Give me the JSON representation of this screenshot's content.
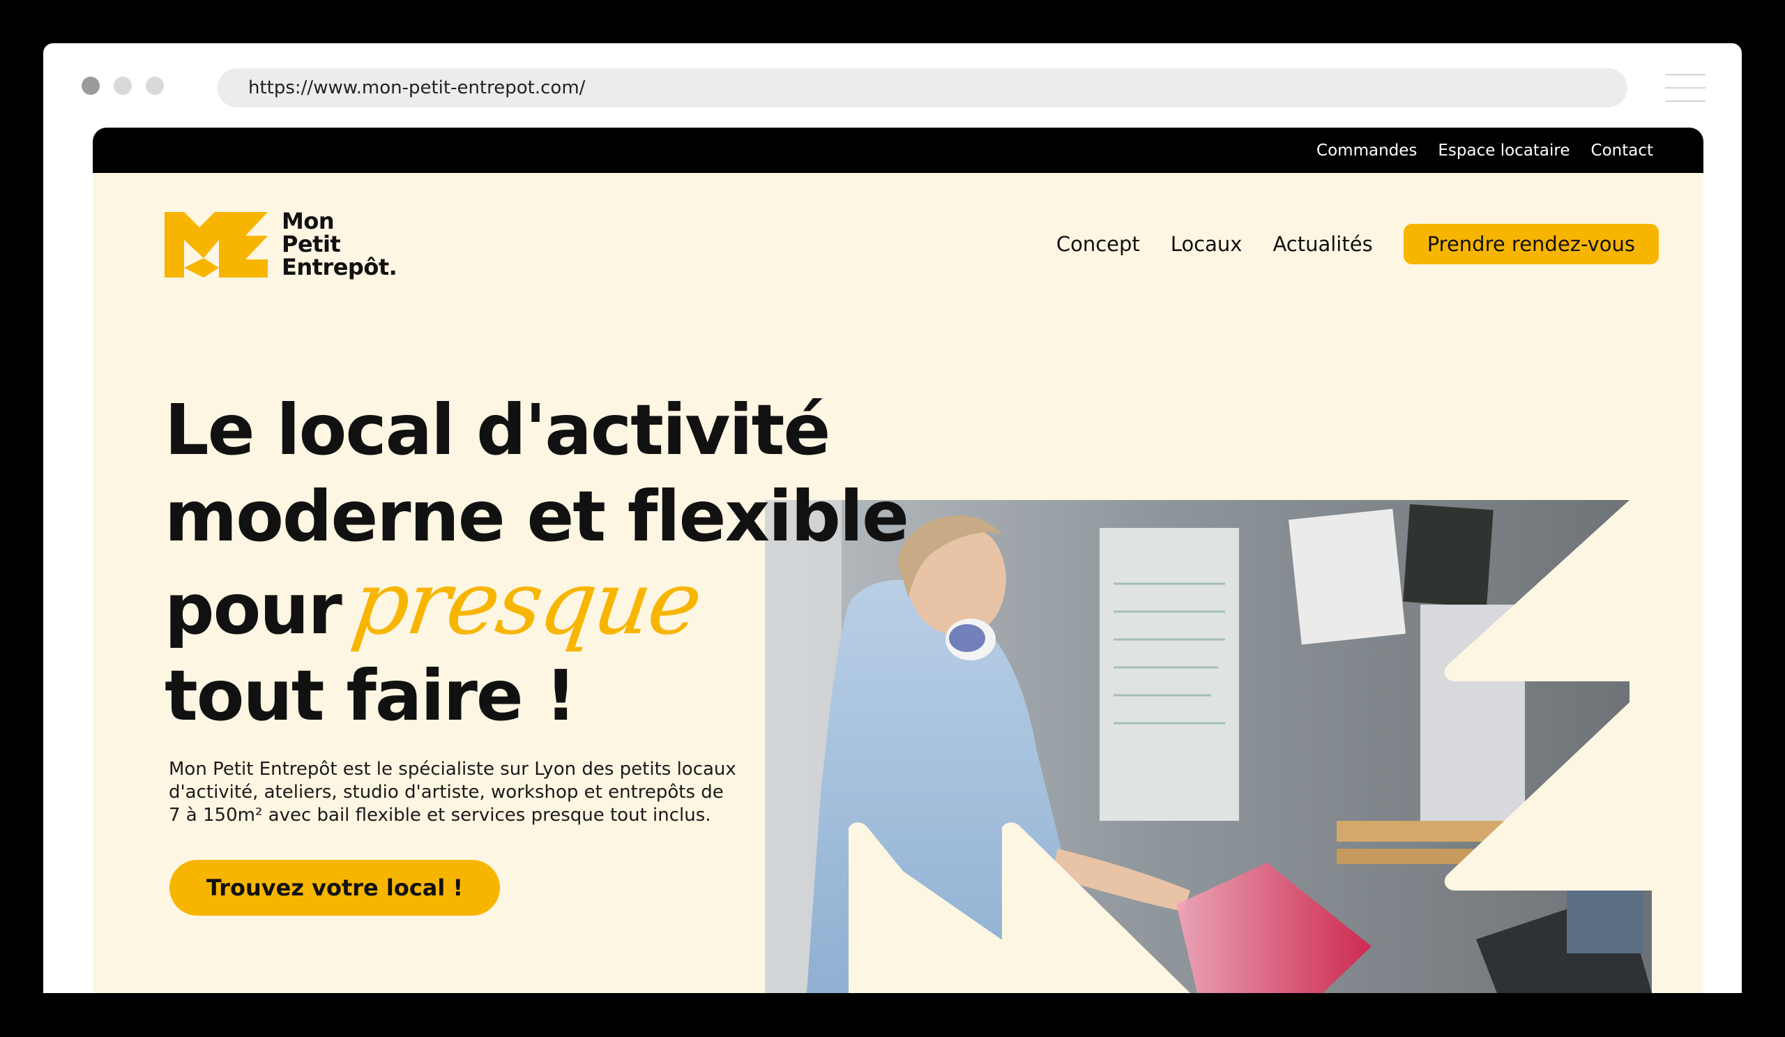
{
  "browser": {
    "url": "https://www.mon-petit-entrepot.com/",
    "dots": [
      "#9a9a9a",
      "#d9d9d9",
      "#d9d9d9"
    ]
  },
  "topbar": {
    "links": [
      "Commandes",
      "Espace locataire",
      "Contact"
    ]
  },
  "logo": {
    "lines": [
      "Mon",
      "Petit",
      "Entrepôt."
    ],
    "mark_color": "#f7b500"
  },
  "nav": {
    "links": [
      "Concept",
      "Locaux",
      "Actualités"
    ],
    "cta": "Prendre rendez-vous"
  },
  "hero": {
    "title_line1": "Le local d'activité",
    "title_line2": "moderne et flexible",
    "title_line3_a": "pour",
    "title_line3_script": "presque",
    "title_line4": "tout faire !",
    "description": "Mon Petit Entrepôt est le spécialiste sur Lyon des petits locaux d'activité, ateliers, studio d'artiste, workshop et entrepôts  de 7 à 150m² avec bail flexible et services presque tout inclus.",
    "button": "Trouvez votre local !"
  },
  "colors": {
    "accent": "#f7b500",
    "background": "#fdf6e3",
    "topbar": "#000000"
  }
}
